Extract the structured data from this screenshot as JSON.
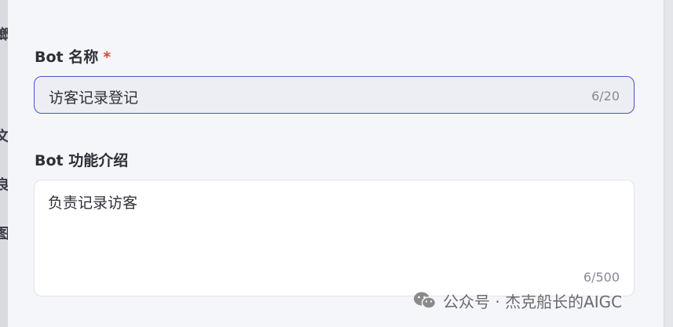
{
  "form": {
    "name_label": "Bot 名称",
    "required_mark": "*",
    "name_value": "访客记录登记",
    "name_counter": "6/20",
    "desc_label": "Bot 功能介绍",
    "desc_value": "负责记录访客",
    "desc_counter": "6/500"
  },
  "backdrop_chars": [
    "螂",
    "文",
    "良",
    "图"
  ],
  "watermark": {
    "text": "公众号 · 杰克船长的AIGC",
    "icon": "wechat-icon"
  },
  "colors": {
    "accent": "#4b54c6",
    "required": "#e2423a",
    "background": "#f5f6fa"
  }
}
